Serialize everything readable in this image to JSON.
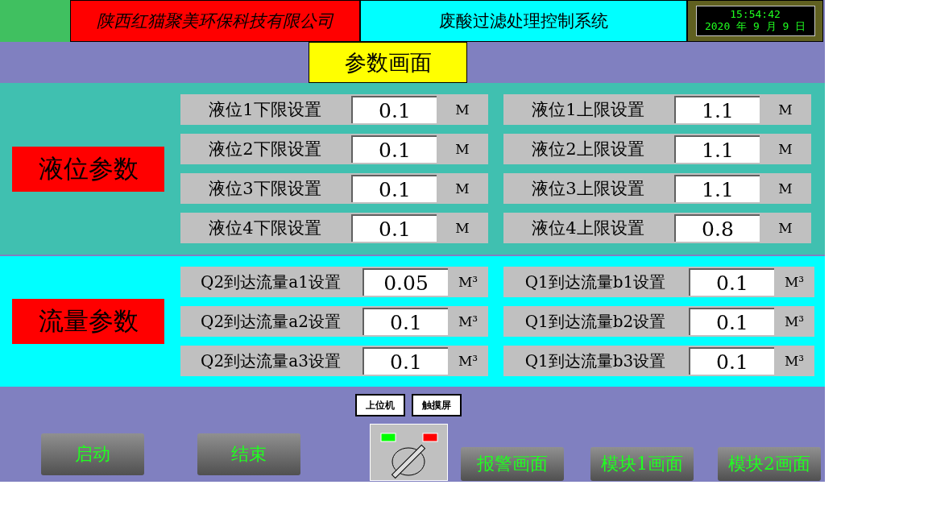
{
  "header": {
    "company": "陕西红猫聚美环保科技有限公司",
    "title": "废酸过滤处理控制系统",
    "clock": {
      "time": "15:54:42",
      "date": "2020 年 9 月 9 日"
    }
  },
  "page_tab": "参数画面",
  "sections": [
    {
      "kind": "level",
      "title": "液位参数",
      "rows": [
        {
          "left": {
            "label": "液位1下限设置",
            "value": "0.1",
            "unit": "M"
          },
          "right": {
            "label": "液位1上限设置",
            "value": "1.1",
            "unit": "M"
          }
        },
        {
          "left": {
            "label": "液位2下限设置",
            "value": "0.1",
            "unit": "M"
          },
          "right": {
            "label": "液位2上限设置",
            "value": "1.1",
            "unit": "M"
          }
        },
        {
          "left": {
            "label": "液位3下限设置",
            "value": "0.1",
            "unit": "M"
          },
          "right": {
            "label": "液位3上限设置",
            "value": "1.1",
            "unit": "M"
          }
        },
        {
          "left": {
            "label": "液位4下限设置",
            "value": "0.1",
            "unit": "M"
          },
          "right": {
            "label": "液位4上限设置",
            "value": "0.8",
            "unit": "M"
          }
        }
      ]
    },
    {
      "kind": "flow",
      "title": "流量参数",
      "rows": [
        {
          "left": {
            "label": "Q2到达流量a1设置",
            "value": "0.05",
            "unit": "M³"
          },
          "right": {
            "label": "Q1到达流量b1设置",
            "value": "0.1",
            "unit": "M³"
          }
        },
        {
          "left": {
            "label": "Q2到达流量a2设置",
            "value": "0.1",
            "unit": "M³"
          },
          "right": {
            "label": "Q1到达流量b2设置",
            "value": "0.1",
            "unit": "M³"
          }
        },
        {
          "left": {
            "label": "Q2到达流量a3设置",
            "value": "0.1",
            "unit": "M³"
          },
          "right": {
            "label": "Q1到达流量b3设置",
            "value": "0.1",
            "unit": "M³"
          }
        }
      ]
    }
  ],
  "mode_labels": [
    "上位机",
    "触摸屏"
  ],
  "buttons": {
    "start": "启动",
    "stop": "结束",
    "alarm": "报警画面",
    "module1": "模块1画面",
    "module2": "模块2画面"
  }
}
